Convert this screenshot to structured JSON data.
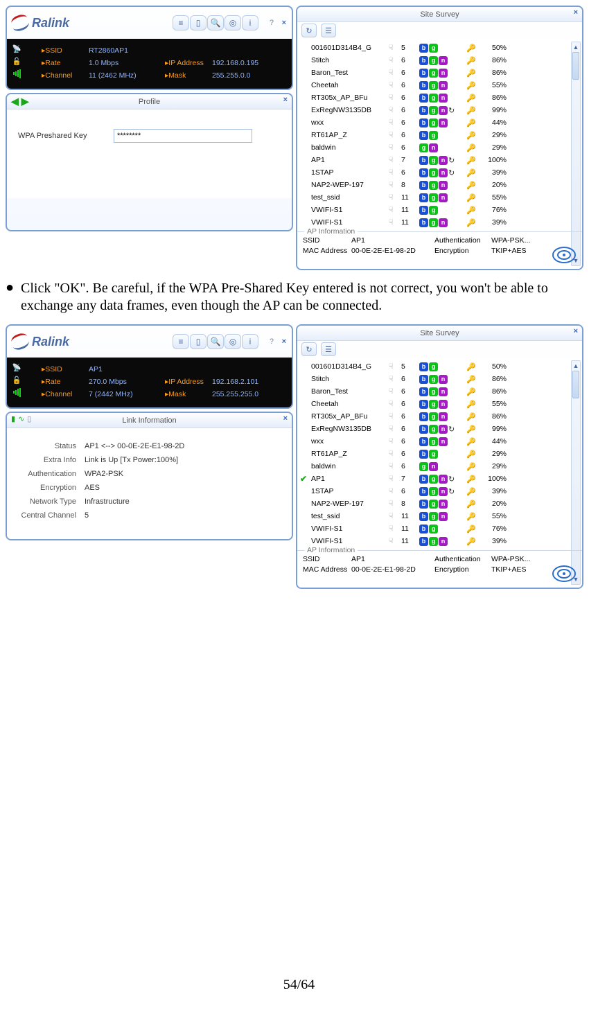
{
  "brand": "Ralink",
  "titles": {
    "profile": "Profile",
    "site_survey": "Site Survey",
    "link_info": "Link Information",
    "ap_info": "AP Information"
  },
  "inst_text": "Click \"OK\". Be careful, if the WPA Pre-Shared Key entered is not correct, you won't be able to exchange any data frames, even though the AP can be connected.",
  "page_number": "54/64",
  "profile": {
    "wpa_label": "WPA Preshared Key",
    "wpa_value": "********"
  },
  "status1": {
    "ssid_label": "SSID",
    "ssid": "RT2860AP1",
    "rate_label": "Rate",
    "rate": "1.0 Mbps",
    "channel_label": "Channel",
    "channel": "11 (2462 MHz)",
    "ip_label": "IP Address",
    "ip": "192.168.0.195",
    "mask_label": "Mask",
    "mask": "255.255.0.0"
  },
  "status2": {
    "ssid_label": "SSID",
    "ssid": "AP1",
    "rate_label": "Rate",
    "rate": "270.0 Mbps",
    "channel_label": "Channel",
    "channel": "7 (2442 MHz)",
    "ip_label": "IP Address",
    "ip": "192.168.2.101",
    "mask_label": "Mask",
    "mask": "255.255.255.0"
  },
  "linkinfo": {
    "rows": [
      {
        "label": "Status",
        "value": "AP1 <--> 00-0E-2E-E1-98-2D"
      },
      {
        "label": "Extra Info",
        "value": "Link is Up  [Tx Power:100%]"
      },
      {
        "label": "Authentication",
        "value": "WPA2-PSK"
      },
      {
        "label": "Encryption",
        "value": "AES"
      },
      {
        "label": "Network Type",
        "value": "Infrastructure"
      },
      {
        "label": "Central Channel",
        "value": "5"
      }
    ]
  },
  "apinfo": {
    "ssid_label": "SSID",
    "ssid": "AP1",
    "mac_label": "MAC Address",
    "mac": "00-0E-2E-E1-98-2D",
    "auth_label": "Authentication",
    "auth": "WPA-PSK...",
    "enc_label": "Encryption",
    "enc": "TKIP+AES"
  },
  "networks": [
    {
      "ssid": "001601D314B4_G",
      "ch": 5,
      "b": true,
      "g": true,
      "n": false,
      "refresh": false,
      "key": true,
      "pct": "50%",
      "connected": false
    },
    {
      "ssid": "Stitch",
      "ch": 6,
      "b": true,
      "g": true,
      "n": true,
      "refresh": false,
      "key": true,
      "pct": "86%",
      "connected": false
    },
    {
      "ssid": "Baron_Test",
      "ch": 6,
      "b": true,
      "g": true,
      "n": true,
      "refresh": false,
      "key": true,
      "pct": "86%",
      "connected": false
    },
    {
      "ssid": "Cheetah",
      "ch": 6,
      "b": true,
      "g": true,
      "n": true,
      "refresh": false,
      "key": true,
      "pct": "55%",
      "connected": false
    },
    {
      "ssid": "RT305x_AP_BFu",
      "ch": 6,
      "b": true,
      "g": true,
      "n": true,
      "refresh": false,
      "key": true,
      "pct": "86%",
      "connected": false
    },
    {
      "ssid": "ExRegNW3135DB",
      "ch": 6,
      "b": true,
      "g": true,
      "n": true,
      "refresh": true,
      "key": true,
      "pct": "99%",
      "connected": false
    },
    {
      "ssid": "wxx",
      "ch": 6,
      "b": true,
      "g": true,
      "n": true,
      "refresh": false,
      "key": true,
      "pct": "44%",
      "connected": false
    },
    {
      "ssid": "RT61AP_Z",
      "ch": 6,
      "b": true,
      "g": true,
      "n": false,
      "refresh": false,
      "key": true,
      "pct": "29%",
      "connected": false
    },
    {
      "ssid": "baldwin",
      "ch": 6,
      "b": false,
      "g": true,
      "n": true,
      "refresh": false,
      "key": true,
      "pct": "29%",
      "connected": false
    },
    {
      "ssid": "AP1",
      "ch": 7,
      "b": true,
      "g": true,
      "n": true,
      "refresh": true,
      "key": true,
      "pct": "100%",
      "connected": false
    },
    {
      "ssid": "1STAP",
      "ch": 6,
      "b": true,
      "g": true,
      "n": true,
      "refresh": true,
      "key": true,
      "pct": "39%",
      "connected": false
    },
    {
      "ssid": "NAP2-WEP-197",
      "ch": 8,
      "b": true,
      "g": true,
      "n": true,
      "refresh": false,
      "key": true,
      "pct": "20%",
      "connected": false
    },
    {
      "ssid": "test_ssid",
      "ch": 11,
      "b": true,
      "g": true,
      "n": true,
      "refresh": false,
      "key": true,
      "pct": "55%",
      "connected": false
    },
    {
      "ssid": "VWIFI-S1",
      "ch": 11,
      "b": true,
      "g": true,
      "n": false,
      "refresh": false,
      "key": true,
      "pct": "76%",
      "connected": false
    },
    {
      "ssid": "VWIFI-S1",
      "ch": 11,
      "b": true,
      "g": true,
      "n": true,
      "refresh": false,
      "key": true,
      "pct": "39%",
      "connected": false
    }
  ],
  "networks2": [
    {
      "ssid": "001601D314B4_G",
      "ch": 5,
      "b": true,
      "g": true,
      "n": false,
      "refresh": false,
      "key": true,
      "pct": "50%",
      "connected": false
    },
    {
      "ssid": "Stitch",
      "ch": 6,
      "b": true,
      "g": true,
      "n": true,
      "refresh": false,
      "key": true,
      "pct": "86%",
      "connected": false
    },
    {
      "ssid": "Baron_Test",
      "ch": 6,
      "b": true,
      "g": true,
      "n": true,
      "refresh": false,
      "key": true,
      "pct": "86%",
      "connected": false
    },
    {
      "ssid": "Cheetah",
      "ch": 6,
      "b": true,
      "g": true,
      "n": true,
      "refresh": false,
      "key": true,
      "pct": "55%",
      "connected": false
    },
    {
      "ssid": "RT305x_AP_BFu",
      "ch": 6,
      "b": true,
      "g": true,
      "n": true,
      "refresh": false,
      "key": true,
      "pct": "86%",
      "connected": false
    },
    {
      "ssid": "ExRegNW3135DB",
      "ch": 6,
      "b": true,
      "g": true,
      "n": true,
      "refresh": true,
      "key": true,
      "pct": "99%",
      "connected": false
    },
    {
      "ssid": "wxx",
      "ch": 6,
      "b": true,
      "g": true,
      "n": true,
      "refresh": false,
      "key": true,
      "pct": "44%",
      "connected": false
    },
    {
      "ssid": "RT61AP_Z",
      "ch": 6,
      "b": true,
      "g": true,
      "n": false,
      "refresh": false,
      "key": true,
      "pct": "29%",
      "connected": false
    },
    {
      "ssid": "baldwin",
      "ch": 6,
      "b": false,
      "g": true,
      "n": true,
      "refresh": false,
      "key": true,
      "pct": "29%",
      "connected": false
    },
    {
      "ssid": "AP1",
      "ch": 7,
      "b": true,
      "g": true,
      "n": true,
      "refresh": true,
      "key": true,
      "pct": "100%",
      "connected": true
    },
    {
      "ssid": "1STAP",
      "ch": 6,
      "b": true,
      "g": true,
      "n": true,
      "refresh": true,
      "key": true,
      "pct": "39%",
      "connected": false
    },
    {
      "ssid": "NAP2-WEP-197",
      "ch": 8,
      "b": true,
      "g": true,
      "n": true,
      "refresh": false,
      "key": true,
      "pct": "20%",
      "connected": false
    },
    {
      "ssid": "test_ssid",
      "ch": 11,
      "b": true,
      "g": true,
      "n": true,
      "refresh": false,
      "key": true,
      "pct": "55%",
      "connected": false
    },
    {
      "ssid": "VWIFI-S1",
      "ch": 11,
      "b": true,
      "g": true,
      "n": false,
      "refresh": false,
      "key": true,
      "pct": "76%",
      "connected": false
    },
    {
      "ssid": "VWIFI-S1",
      "ch": 11,
      "b": true,
      "g": true,
      "n": true,
      "refresh": false,
      "key": true,
      "pct": "39%",
      "connected": false
    }
  ]
}
